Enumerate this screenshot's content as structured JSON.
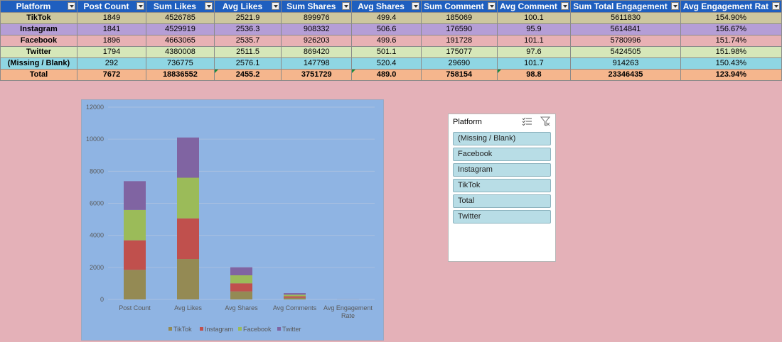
{
  "table": {
    "headers": [
      "Platform",
      "Post Count",
      "Sum Likes",
      "Avg Likes",
      "Sum Shares",
      "Avg Shares",
      "Sum Comment",
      "Avg Comment",
      "Sum Total Engagement",
      "Avg Engagement Rat"
    ],
    "rows": [
      {
        "platform": "TikTok",
        "post_count": "1849",
        "sum_likes": "4526785",
        "avg_likes": "2521.9",
        "sum_shares": "899976",
        "avg_shares": "499.4",
        "sum_comments": "185069",
        "avg_comments": "100.1",
        "sum_total_engagement": "5611830",
        "avg_engagement_rate": "154.90%"
      },
      {
        "platform": "Instagram",
        "post_count": "1841",
        "sum_likes": "4529919",
        "avg_likes": "2536.3",
        "sum_shares": "908332",
        "avg_shares": "506.6",
        "sum_comments": "176590",
        "avg_comments": "95.9",
        "sum_total_engagement": "5614841",
        "avg_engagement_rate": "156.67%"
      },
      {
        "platform": "Facebook",
        "post_count": "1896",
        "sum_likes": "4663065",
        "avg_likes": "2535.7",
        "sum_shares": "926203",
        "avg_shares": "499.6",
        "sum_comments": "191728",
        "avg_comments": "101.1",
        "sum_total_engagement": "5780996",
        "avg_engagement_rate": "151.74%"
      },
      {
        "platform": "Twitter",
        "post_count": "1794",
        "sum_likes": "4380008",
        "avg_likes": "2511.5",
        "sum_shares": "869420",
        "avg_shares": "501.1",
        "sum_comments": "175077",
        "avg_comments": "97.6",
        "sum_total_engagement": "5424505",
        "avg_engagement_rate": "151.98%"
      },
      {
        "platform": "(Missing / Blank)",
        "post_count": "292",
        "sum_likes": "736775",
        "avg_likes": "2576.1",
        "sum_shares": "147798",
        "avg_shares": "520.4",
        "sum_comments": "29690",
        "avg_comments": "101.7",
        "sum_total_engagement": "914263",
        "avg_engagement_rate": "150.43%"
      },
      {
        "platform": "Total",
        "post_count": "7672",
        "sum_likes": "18836552",
        "avg_likes": "2455.2",
        "sum_shares": "3751729",
        "avg_shares": "489.0",
        "sum_comments": "758154",
        "avg_comments": "98.8",
        "sum_total_engagement": "23346435",
        "avg_engagement_rate": "123.94%"
      }
    ]
  },
  "slicer": {
    "title": "Platform",
    "items": [
      "(Missing / Blank)",
      "Facebook",
      "Instagram",
      "TikTok",
      "Total",
      "Twitter"
    ]
  },
  "colors": {
    "tiktok": "#948a54",
    "instagram": "#c0504d",
    "facebook": "#9bbb59",
    "twitter": "#8064a2"
  },
  "chart_data": {
    "type": "bar",
    "stacked": true,
    "categories": [
      "Post Count",
      "Avg Likes",
      "Avg Shares",
      "Avg Comments",
      "Avg Engagement Rate"
    ],
    "series": [
      {
        "name": "TikTok",
        "values": [
          1849,
          2521.9,
          499.4,
          100.1,
          1.549
        ]
      },
      {
        "name": "Instagram",
        "values": [
          1841,
          2536.3,
          506.6,
          95.9,
          1.5667
        ]
      },
      {
        "name": "Facebook",
        "values": [
          1896,
          2535.7,
          499.6,
          101.1,
          1.5174
        ]
      },
      {
        "name": "Twitter",
        "values": [
          1794,
          2511.5,
          501.1,
          97.6,
          1.5198
        ]
      }
    ],
    "yticks": [
      "0",
      "2000",
      "4000",
      "6000",
      "8000",
      "10000",
      "12000"
    ],
    "ylim": [
      0,
      12000
    ],
    "grid": true,
    "legend": "bottom"
  }
}
